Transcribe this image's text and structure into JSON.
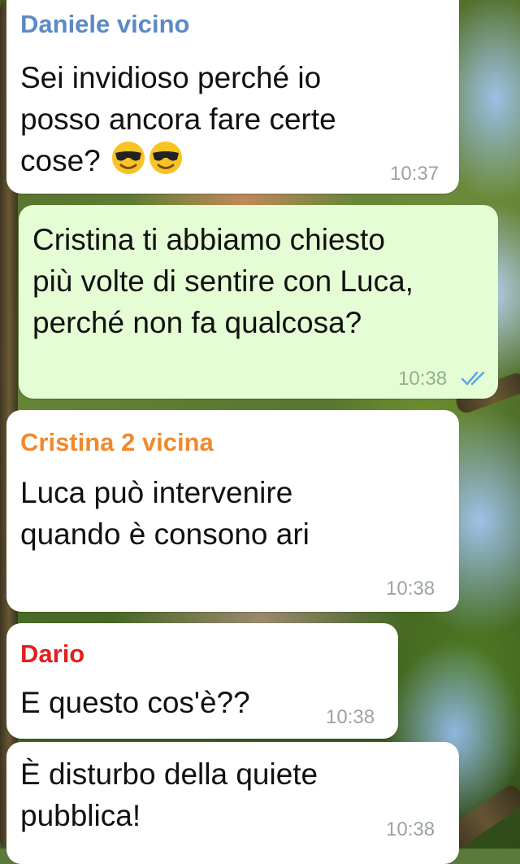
{
  "messages": [
    {
      "sender": "Daniele vicino",
      "sender_color": "#5b8ac4",
      "lines": [
        "Sei invidioso perché io",
        "posso ancora fare certe",
        "cose? "
      ],
      "emoji": [
        "sunglasses-emoji",
        "sunglasses-emoji"
      ],
      "time": "10:37",
      "outgoing": false
    },
    {
      "sender": "",
      "lines": [
        "Cristina ti abbiamo chiesto",
        "più volte di sentire con Luca,",
        "perché non fa qualcosa?"
      ],
      "time": "10:38",
      "status": "read-double-check",
      "outgoing": true
    },
    {
      "sender": "Cristina 2 vicina",
      "sender_color": "#f0892c",
      "lines": [
        "Luca può intervenire",
        "quando è consono ari"
      ],
      "time": "10:38",
      "outgoing": false
    },
    {
      "sender": "Dario",
      "sender_color": "#e0211f",
      "lines": [
        "E questo cos'è??"
      ],
      "time": "10:38",
      "outgoing": false
    },
    {
      "sender": "",
      "lines": [
        "È disturbo della quiete",
        "pubblica!"
      ],
      "time": "10:38",
      "outgoing": false
    }
  ],
  "colors": {
    "incoming_bubble": "#ffffff",
    "outgoing_bubble": "#e4fdd4",
    "read_ticks": "#5ba6e0"
  }
}
